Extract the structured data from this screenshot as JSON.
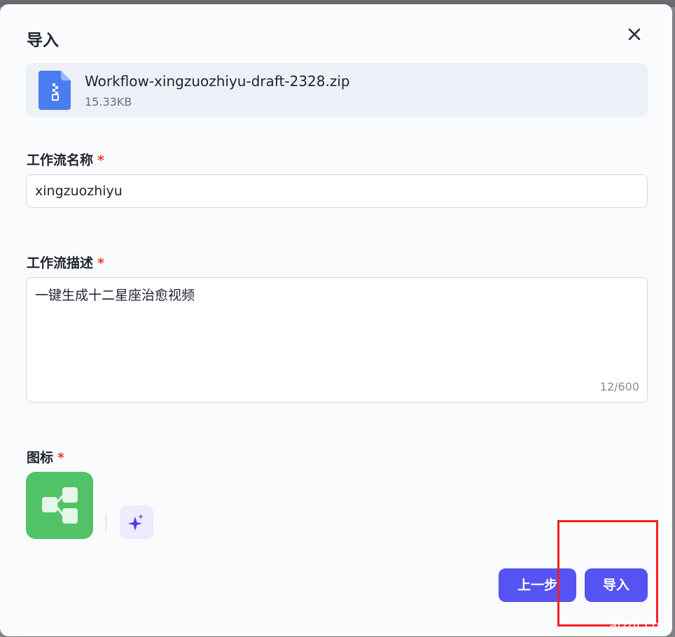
{
  "dialog": {
    "title": "导入"
  },
  "file": {
    "name": "Workflow-xingzuozhiyu-draft-2328.zip",
    "size": "15.33KB",
    "icon": "zip-file-icon"
  },
  "form": {
    "name_label": "工作流名称",
    "name_value": "xingzuozhiyu",
    "desc_label": "工作流描述",
    "desc_value": "一键生成十二星座治愈视频",
    "desc_count": "12/600",
    "icon_label": "图标",
    "required_mark": "*"
  },
  "buttons": {
    "prev": "上一步",
    "import": "导入"
  },
  "watermark": "aizhi.com",
  "colors": {
    "primary": "#5753f2",
    "required": "#e0442f",
    "icon_tile": "#52c267",
    "highlight": "#f32020"
  }
}
